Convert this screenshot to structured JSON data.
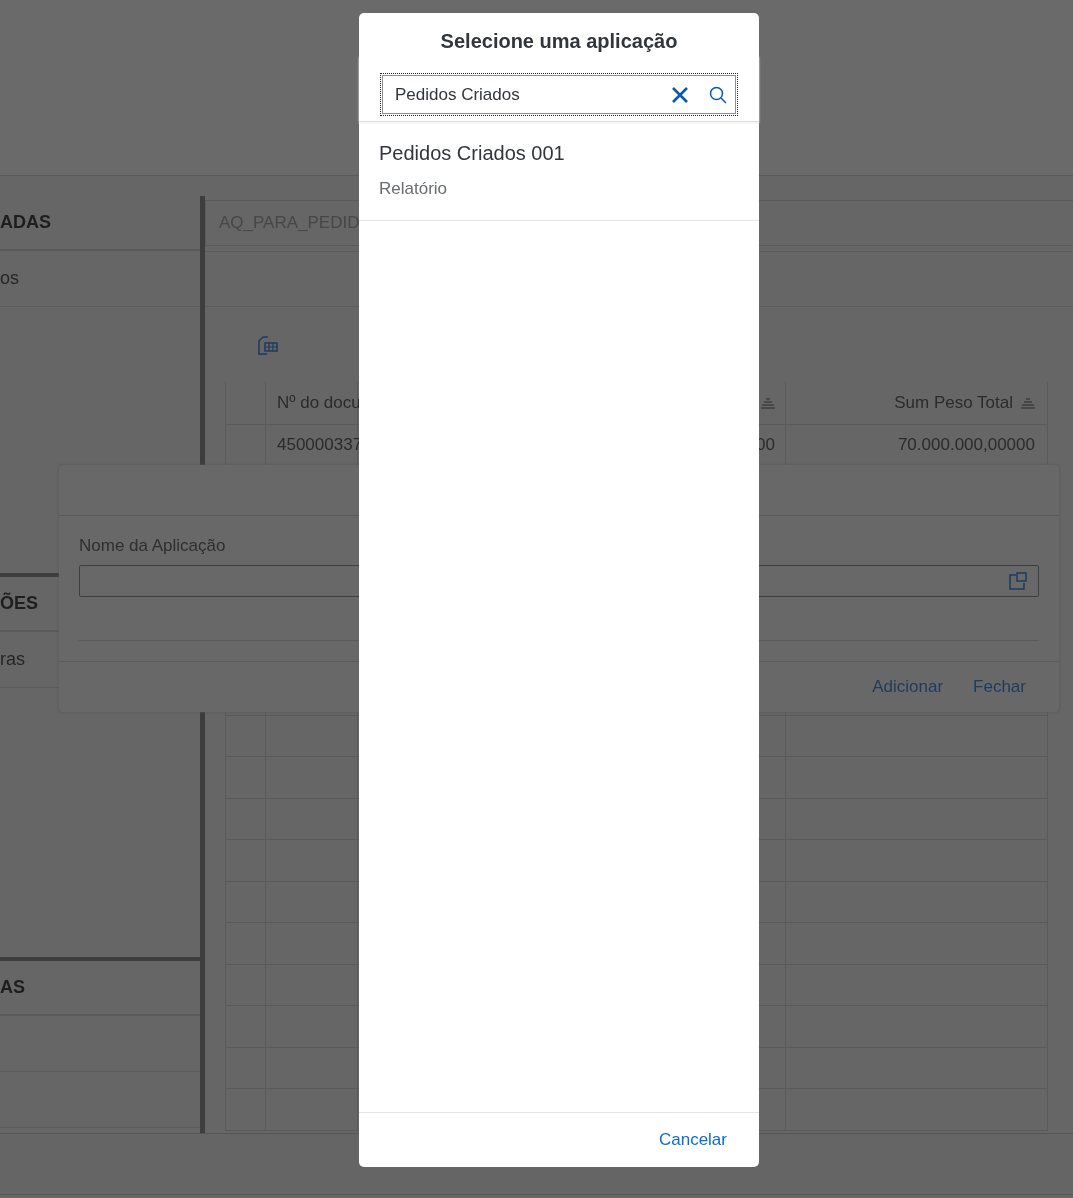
{
  "background": {
    "sidebar": {
      "sections": [
        {
          "title": "ADAS",
          "items": [
            "os"
          ]
        },
        {
          "title": "ÕES",
          "items": [
            "ras"
          ]
        },
        {
          "title": "AS"
        }
      ]
    },
    "content": {
      "query_field": {
        "value": "AQ_PARA_PEDID"
      },
      "table": {
        "columns": [
          {
            "label": "Nº do docu"
          },
          {
            "sortable": true
          },
          {
            "label": "Sum Peso Total",
            "sortable": true
          }
        ],
        "rows": [
          [
            "450000337",
            "00",
            "70.000.000,00000"
          ]
        ]
      }
    },
    "add_dialog": {
      "field_label": "Nome da Aplicação",
      "buttons": [
        "Adicionar",
        "Fechar"
      ]
    }
  },
  "select_dialog": {
    "title": "Selecione uma aplicação",
    "search": {
      "value": "Pedidos Criados"
    },
    "results": [
      {
        "name": "Pedidos Criados 001",
        "type": "Relatório"
      }
    ],
    "buttons": [
      "Cancelar"
    ]
  }
}
